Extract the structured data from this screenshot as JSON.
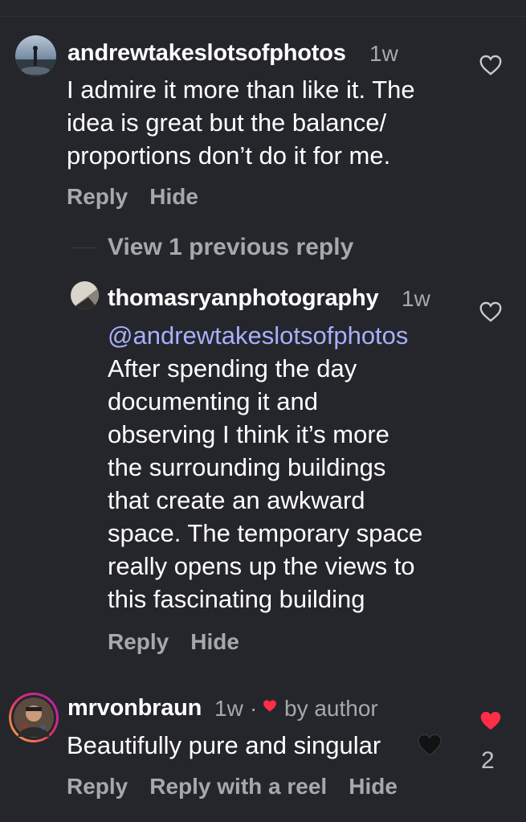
{
  "comments": [
    {
      "username": "andrewtakeslotsofphotos",
      "time": "1w",
      "lines": [
        "I admire it more than like it. The",
        "idea is great but the balance/",
        "proportions don’t do it for me."
      ],
      "actions": [
        "Reply",
        "Hide"
      ]
    },
    {
      "view_replies_label": "View 1 previous reply"
    },
    {
      "username": "thomasryanphotography",
      "time": "1w",
      "mention": "@andrewtakeslotsofphotos",
      "lines": [
        "After spending the day",
        "documenting it and",
        "observing I think it’s more",
        "the surrounding buildings",
        "that create an awkward",
        "space. The temporary space",
        "really opens up the views to",
        "this fascinating building"
      ],
      "actions": [
        "Reply",
        "Hide"
      ]
    },
    {
      "username": "mrvonbraun",
      "time": "1w",
      "separator": "·",
      "liked_by": "by author",
      "text": "Beautifully pure and singular",
      "like_count": "2",
      "actions": [
        "Reply",
        "Reply with a reel",
        "Hide"
      ]
    }
  ],
  "colors": {
    "background": "#24262b",
    "secondary_text": "#a6a8ad",
    "mention": "#a8b0ff",
    "like_red": "#ff2d46"
  }
}
